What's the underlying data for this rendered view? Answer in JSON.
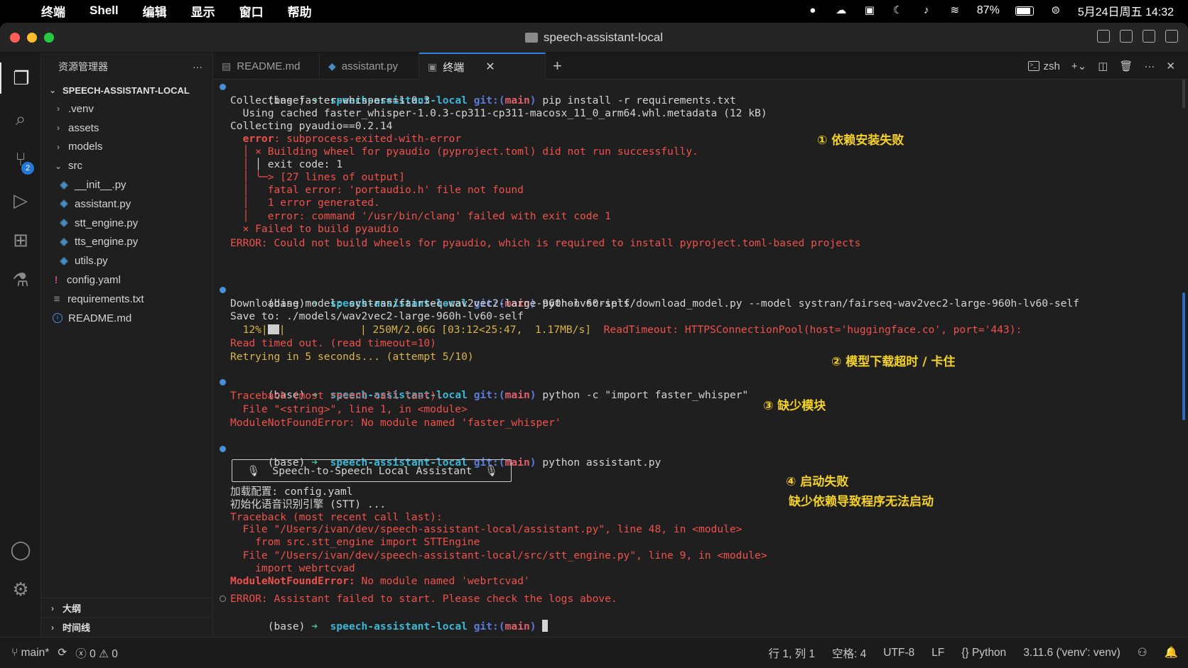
{
  "menubar": {
    "app": "终端",
    "items": [
      "Shell",
      "编辑",
      "显示",
      "窗口",
      "帮助"
    ],
    "battery": "87%",
    "datetime": "5月24日周五 14:32"
  },
  "window": {
    "title": "speech-assistant-local"
  },
  "sidebar": {
    "header": "资源管理器",
    "more": "···",
    "root": "SPEECH-ASSISTANT-LOCAL",
    "items": [
      {
        "label": ".venv"
      },
      {
        "label": "assets"
      },
      {
        "label": "models"
      },
      {
        "label": "src"
      },
      {
        "label": "__init__.py"
      },
      {
        "label": "assistant.py"
      },
      {
        "label": "stt_engine.py"
      },
      {
        "label": "tts_engine.py"
      },
      {
        "label": "utils.py"
      },
      {
        "label": "config.yaml"
      },
      {
        "label": "requirements.txt"
      },
      {
        "label": "README.md"
      }
    ],
    "outline": "大纲",
    "timeline": "时间线"
  },
  "activity": {
    "scm_badge": "2"
  },
  "tabs": [
    {
      "label": "README.md"
    },
    {
      "label": "assistant.py"
    },
    {
      "label": "终端"
    }
  ],
  "terminal_toolbar": {
    "shell": "zsh"
  },
  "terminal": {
    "prompt_env": "(base)",
    "prompt_arrow": "➜",
    "prompt_dir": "speech-assistant-local",
    "prompt_git": "git:(",
    "prompt_branch": "main",
    "prompt_git_close": ")",
    "cmd1": "pip install -r requirements.txt",
    "l1_1": "Collecting faster-whisper==1.0.3",
    "l1_2": "  Using cached faster_whisper-1.0.3-cp311-cp311-macosx_11_0_arm64.whl.metadata (12 kB)",
    "l1_3": "Collecting pyaudio==0.2.14",
    "l1_4a": "  error",
    "l1_4b": ": subprocess-exited-with-error",
    "l1_5": "  │ × Building wheel for pyaudio (pyproject.toml) did not run successfully.",
    "l1_6a": "  │ ",
    "l1_6b": "│ exit code: 1",
    "l1_7a": "  │ ",
    "l1_7b": "╰─> [27 lines of output]",
    "l1_8": "  │   fatal error: 'portaudio.h' file not found",
    "l1_9": "  │   1 error generated.",
    "l1_10": "  │   error: command '/usr/bin/clang' failed with exit code 1",
    "l1_11": "  × Failed to build pyaudio",
    "l1_12": "ERROR: Could not build wheels for pyaudio, which is required to install pyproject.toml-based projects",
    "cmd2": "python scripts/download_model.py --model systran/fairseq-wav2vec2-large-960h-lv60-self",
    "l2_1": "Downloading model: systran/fairseq-wav2vec2-large-960h-lv60-self",
    "l2_2": "Save to: ./models/wav2vec2-large-960h-lv60-self",
    "l2_3a": "  12%|",
    "l2_3b": "|            | 250M/2.06G [03:12<25:47,  1.17MB/s]  ",
    "l2_3c": "ReadTimeout: HTTPSConnectionPool(host='huggingface.co', port='443):",
    "l2_4": "Read timed out. (read timeout=10)",
    "l2_5": "Retrying in 5 seconds... (attempt 5/10)",
    "cmd3": "python -c \"import faster_whisper\"",
    "l3_1": "Traceback (most recent call last):",
    "l3_2": "  File \"<string>\", line 1, in <module>",
    "l3_3": "ModuleNotFoundError: No module named 'faster_whisper'",
    "cmd4": "python assistant.py",
    "banner": "🎙  Speech-to-Speech Local Assistant  🎙",
    "l4_1": "加载配置: config.yaml",
    "l4_2": "初始化语音识别引擎 (STT) ...",
    "l4_3": "Traceback (most recent call last):",
    "l4_4": "  File \"/Users/ivan/dev/speech-assistant-local/assistant.py\", line 48, in <module>",
    "l4_5": "    from src.stt_engine import STTEngine",
    "l4_6": "  File \"/Users/ivan/dev/speech-assistant-local/src/stt_engine.py\", line 9, in <module>",
    "l4_7": "    import webrtcvad",
    "l4_8a": "ModuleNotFoundError:",
    "l4_8b": " No module named 'webrtcvad'",
    "l4_9": "ERROR: Assistant failed to start. Please check the logs above."
  },
  "annotations": {
    "a1": "① 依赖安装失败",
    "a2": "② 模型下载超时 / 卡住",
    "a3": "③ 缺少模块",
    "a4a": "④ 启动失败",
    "a4b": "缺少依赖导致程序无法启动",
    "color": "#f5d226"
  },
  "statusbar": {
    "branch": "main*",
    "errors": "0",
    "warnings": "0",
    "position": "行 1, 列 1",
    "spaces": "空格: 4",
    "encoding": "UTF-8",
    "eol": "LF",
    "language": "Python",
    "interpreter": "3.11.6 ('venv': venv)"
  }
}
